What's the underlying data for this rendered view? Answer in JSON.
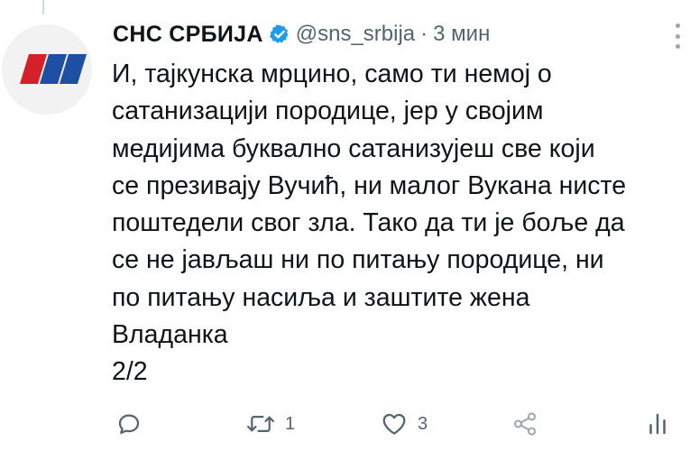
{
  "tweet": {
    "author_name": "СНС СРБИЈА",
    "handle": "@sns_srbija",
    "separator": "·",
    "time": "3 мин",
    "lines": [
      "И, тајкунска мрцино, само ти немој о",
      "сатанизацији породице, јер у својим",
      "медијима буквално сатанизујеш све који",
      "се презивају Вучић, ни малог Вукана нисте",
      "поштедели свог зла. Тако да ти је боље да",
      "се не јављаш ни по питању породице, ни",
      "по питању насиља и заштите жена",
      "Владанка",
      "2/2"
    ]
  },
  "actions": {
    "reply_count": "",
    "retweet_count": "1",
    "like_count": "3"
  },
  "icons": {
    "avatar_logo": "sns-logo-flag-stripes",
    "verified": "verified-badge-icon",
    "more": "more-vertical-icon",
    "reply": "reply-icon",
    "retweet": "retweet-icon",
    "like": "heart-icon",
    "share": "share-icon",
    "analytics": "analytics-icon"
  },
  "colors": {
    "logo_red": "#d32029",
    "logo_blue": "#1f4fa3",
    "verified_blue": "#1d9bf0",
    "muted": "#536471"
  }
}
